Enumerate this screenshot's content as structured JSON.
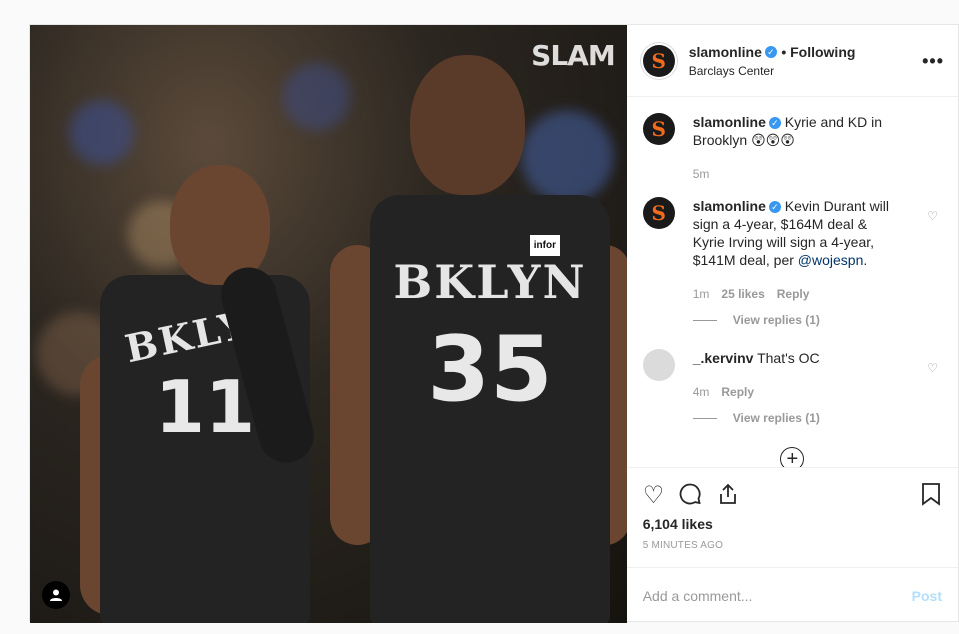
{
  "photo": {
    "watermark": "SLAM",
    "player_left": {
      "wordmark": "BKLYN",
      "number": "11"
    },
    "player_right": {
      "wordmark": "BKLYN",
      "number": "35",
      "patch": "infor"
    }
  },
  "header": {
    "username": "slamonline",
    "follow_status": "• Following",
    "location": "Barclays Center",
    "more": "•••"
  },
  "comments": [
    {
      "username": "slamonline",
      "text": "Kyrie and KD in Brooklyn 😲😲😲",
      "time": "5m"
    },
    {
      "username": "slamonline",
      "text": "Kevin Durant will sign a 4-year, $164M deal & Kyrie Irving will sign a 4-year, $141M deal, per ",
      "mention": "@wojespn",
      "after": ".",
      "time": "1m",
      "likes": "25 likes",
      "reply": "Reply",
      "view_replies": "View replies (1)"
    },
    {
      "username": "_.kervinv",
      "text": "That's OC",
      "time": "4m",
      "reply": "Reply",
      "view_replies": "View replies (1)"
    }
  ],
  "load_more": "+",
  "actions": {
    "likes": "6,104 likes",
    "time_ago": "5 MINUTES AGO"
  },
  "add_comment": {
    "placeholder": "Add a comment...",
    "post": "Post"
  },
  "colors": {
    "verified": "#3897f0",
    "brand_orange": "#f26b1d",
    "post_disabled": "#b2dffc"
  }
}
